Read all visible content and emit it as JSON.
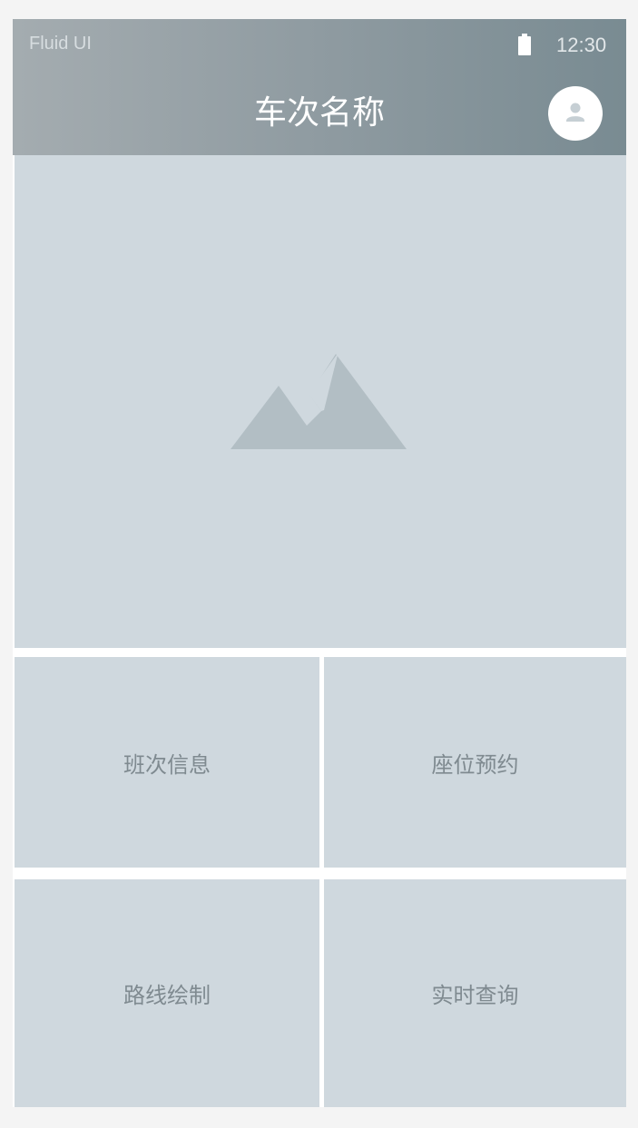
{
  "status_bar": {
    "app_name": "Fluid UI",
    "time": "12:30",
    "battery_icon": "battery-icon"
  },
  "header": {
    "title": "车次名称",
    "avatar_icon": "user-avatar-icon",
    "gradient_start": "#a4acb0",
    "gradient_end": "#798b92"
  },
  "hero": {
    "icon": "image-placeholder-icon",
    "background": "#cfd8de"
  },
  "menu": {
    "items": [
      {
        "label": "班次信息"
      },
      {
        "label": "座位预约"
      },
      {
        "label": "路线绘制"
      },
      {
        "label": "实时查询"
      }
    ]
  }
}
